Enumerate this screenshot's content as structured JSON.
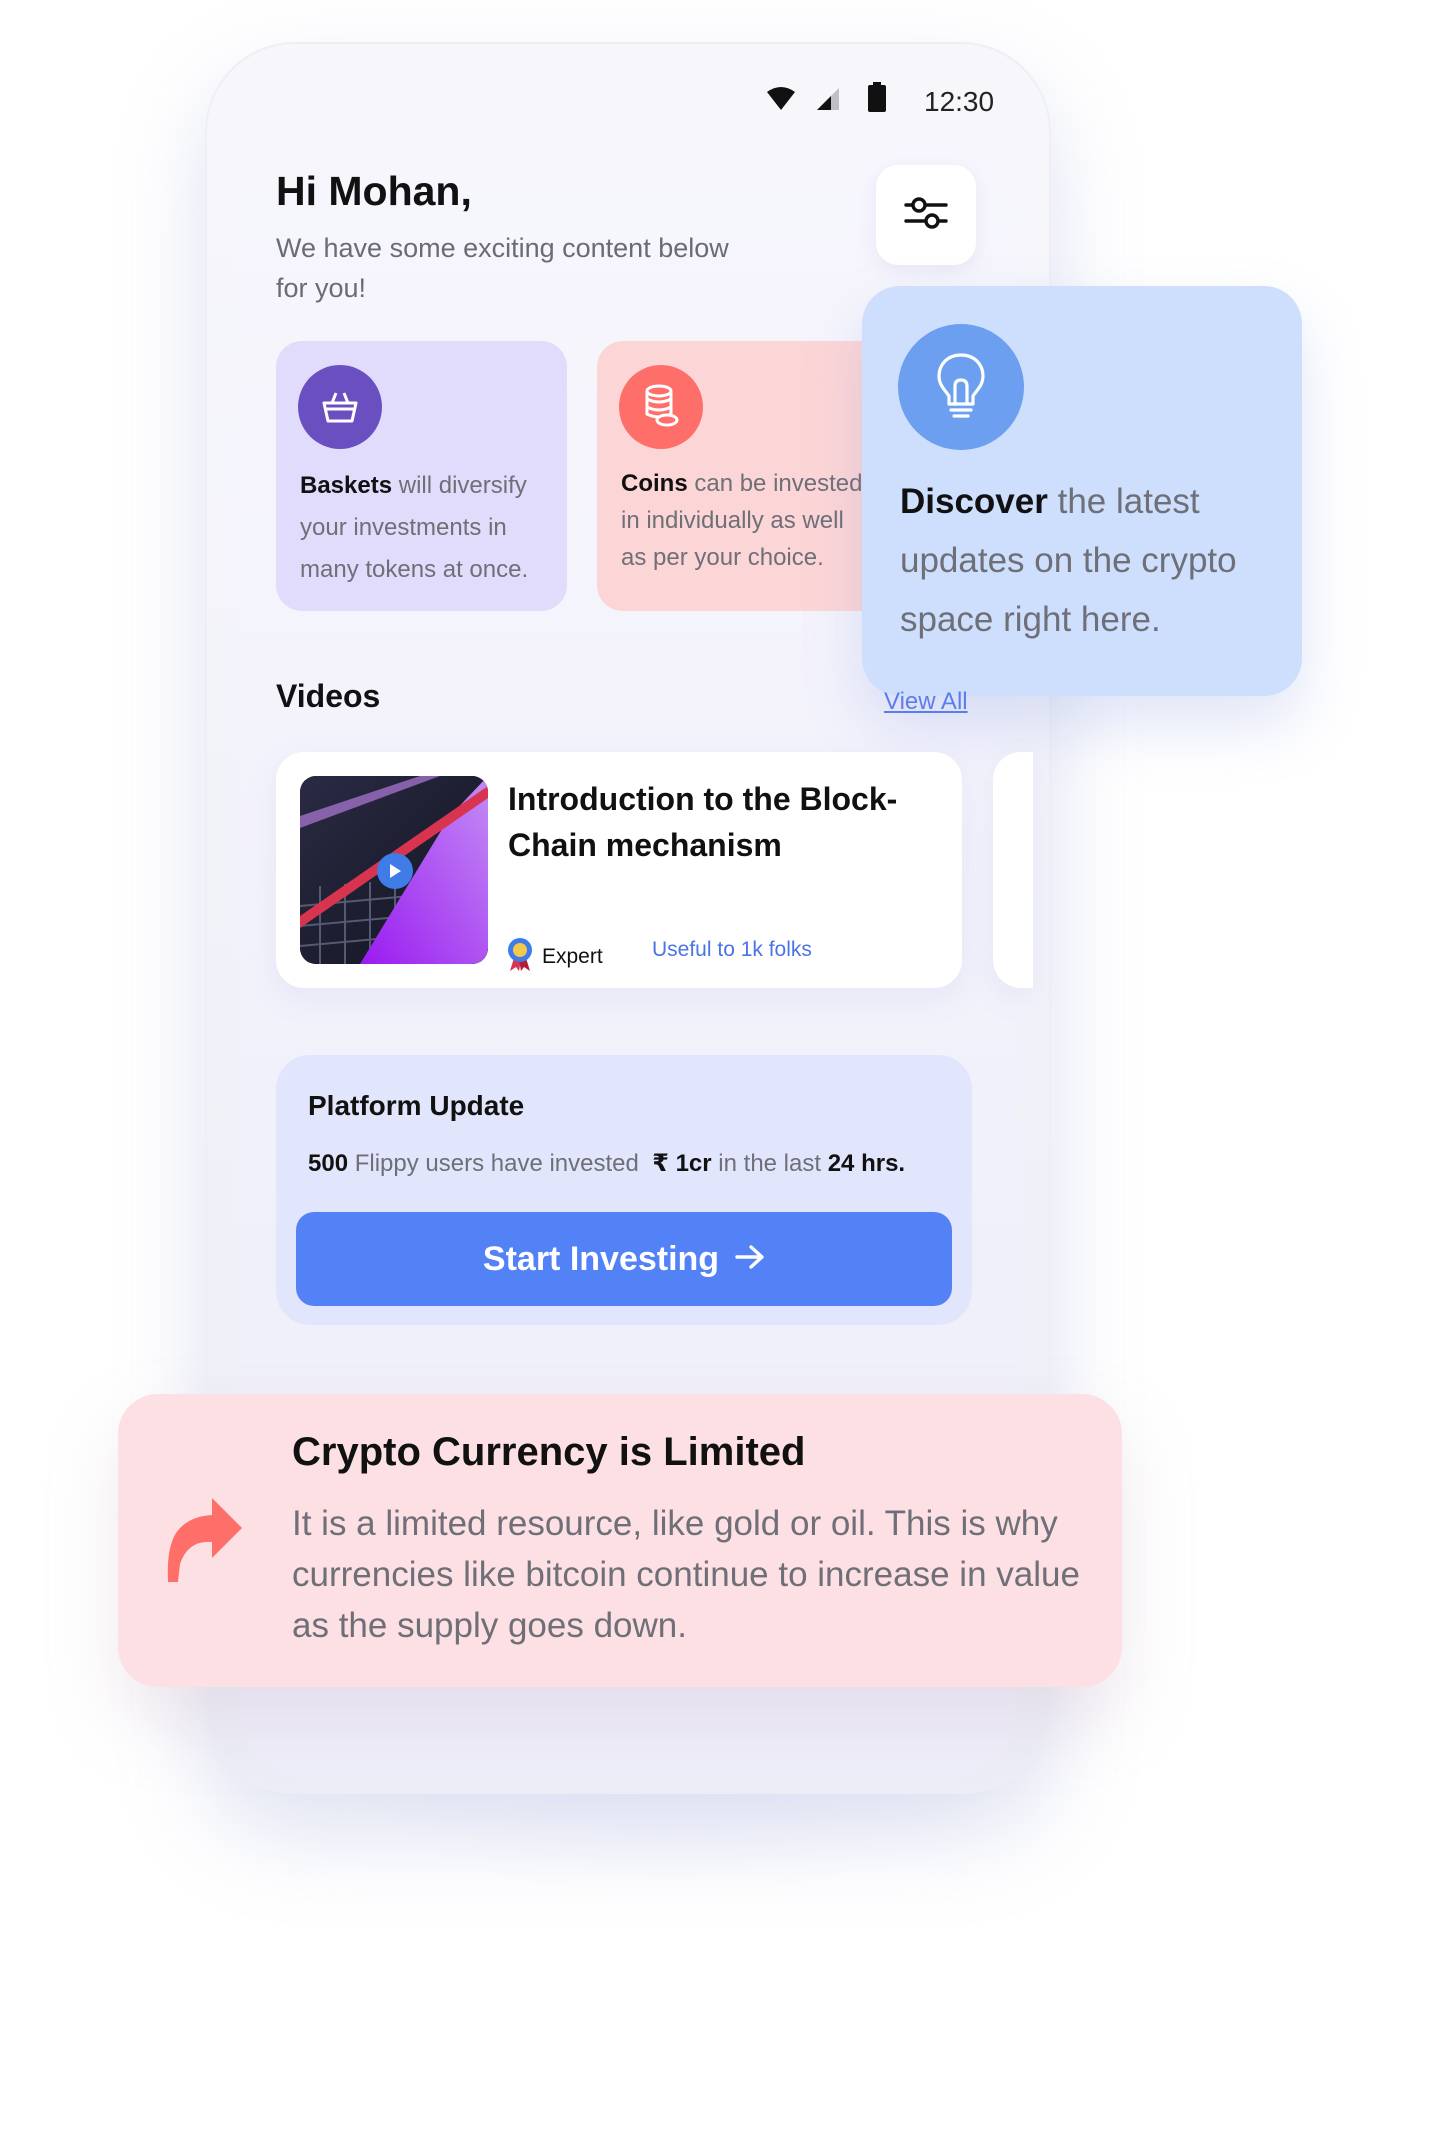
{
  "status_bar": {
    "time": "12:30"
  },
  "header": {
    "greeting": "Hi Mohan,",
    "subtitle": "We have some exciting content below for you!"
  },
  "cards": [
    {
      "title": "Baskets",
      "text": "will diversify your investments in many tokens at once.",
      "color": "#e1dcfb",
      "icon": "basket-icon"
    },
    {
      "title": "Coins",
      "text_lines": [
        "can be invested",
        "in individually as well",
        "as per your choice."
      ],
      "color": "#fcd6d6",
      "icon": "coins-icon"
    }
  ],
  "discover": {
    "bold": "Discover",
    "text": "the latest updates on the crypto space right here.",
    "icon": "lightbulb-icon"
  },
  "videos": {
    "title": "Videos",
    "view_all": "View All",
    "items": [
      {
        "title": "Introduction to the Block-Chain mechanism",
        "badge": "Expert",
        "useful": "Useful to 1k folks"
      }
    ]
  },
  "platform_update": {
    "title": "Platform Update",
    "users_count": "500",
    "users_text": "Flippy users have invested",
    "amount": "₹ 1cr",
    "period_text": "in the last",
    "period": "24 hrs.",
    "button": "Start Investing"
  },
  "limited": {
    "title": "Crypto Currency is Limited",
    "text": "It is a limited resource, like gold or oil. This is why currencies like bitcoin continue to increase in value as the supply goes down."
  },
  "colors": {
    "accent": "#5381f6",
    "link": "#4b73e6",
    "basket_purple": "#6a4fc1",
    "coin_red": "#ff6f6a"
  }
}
